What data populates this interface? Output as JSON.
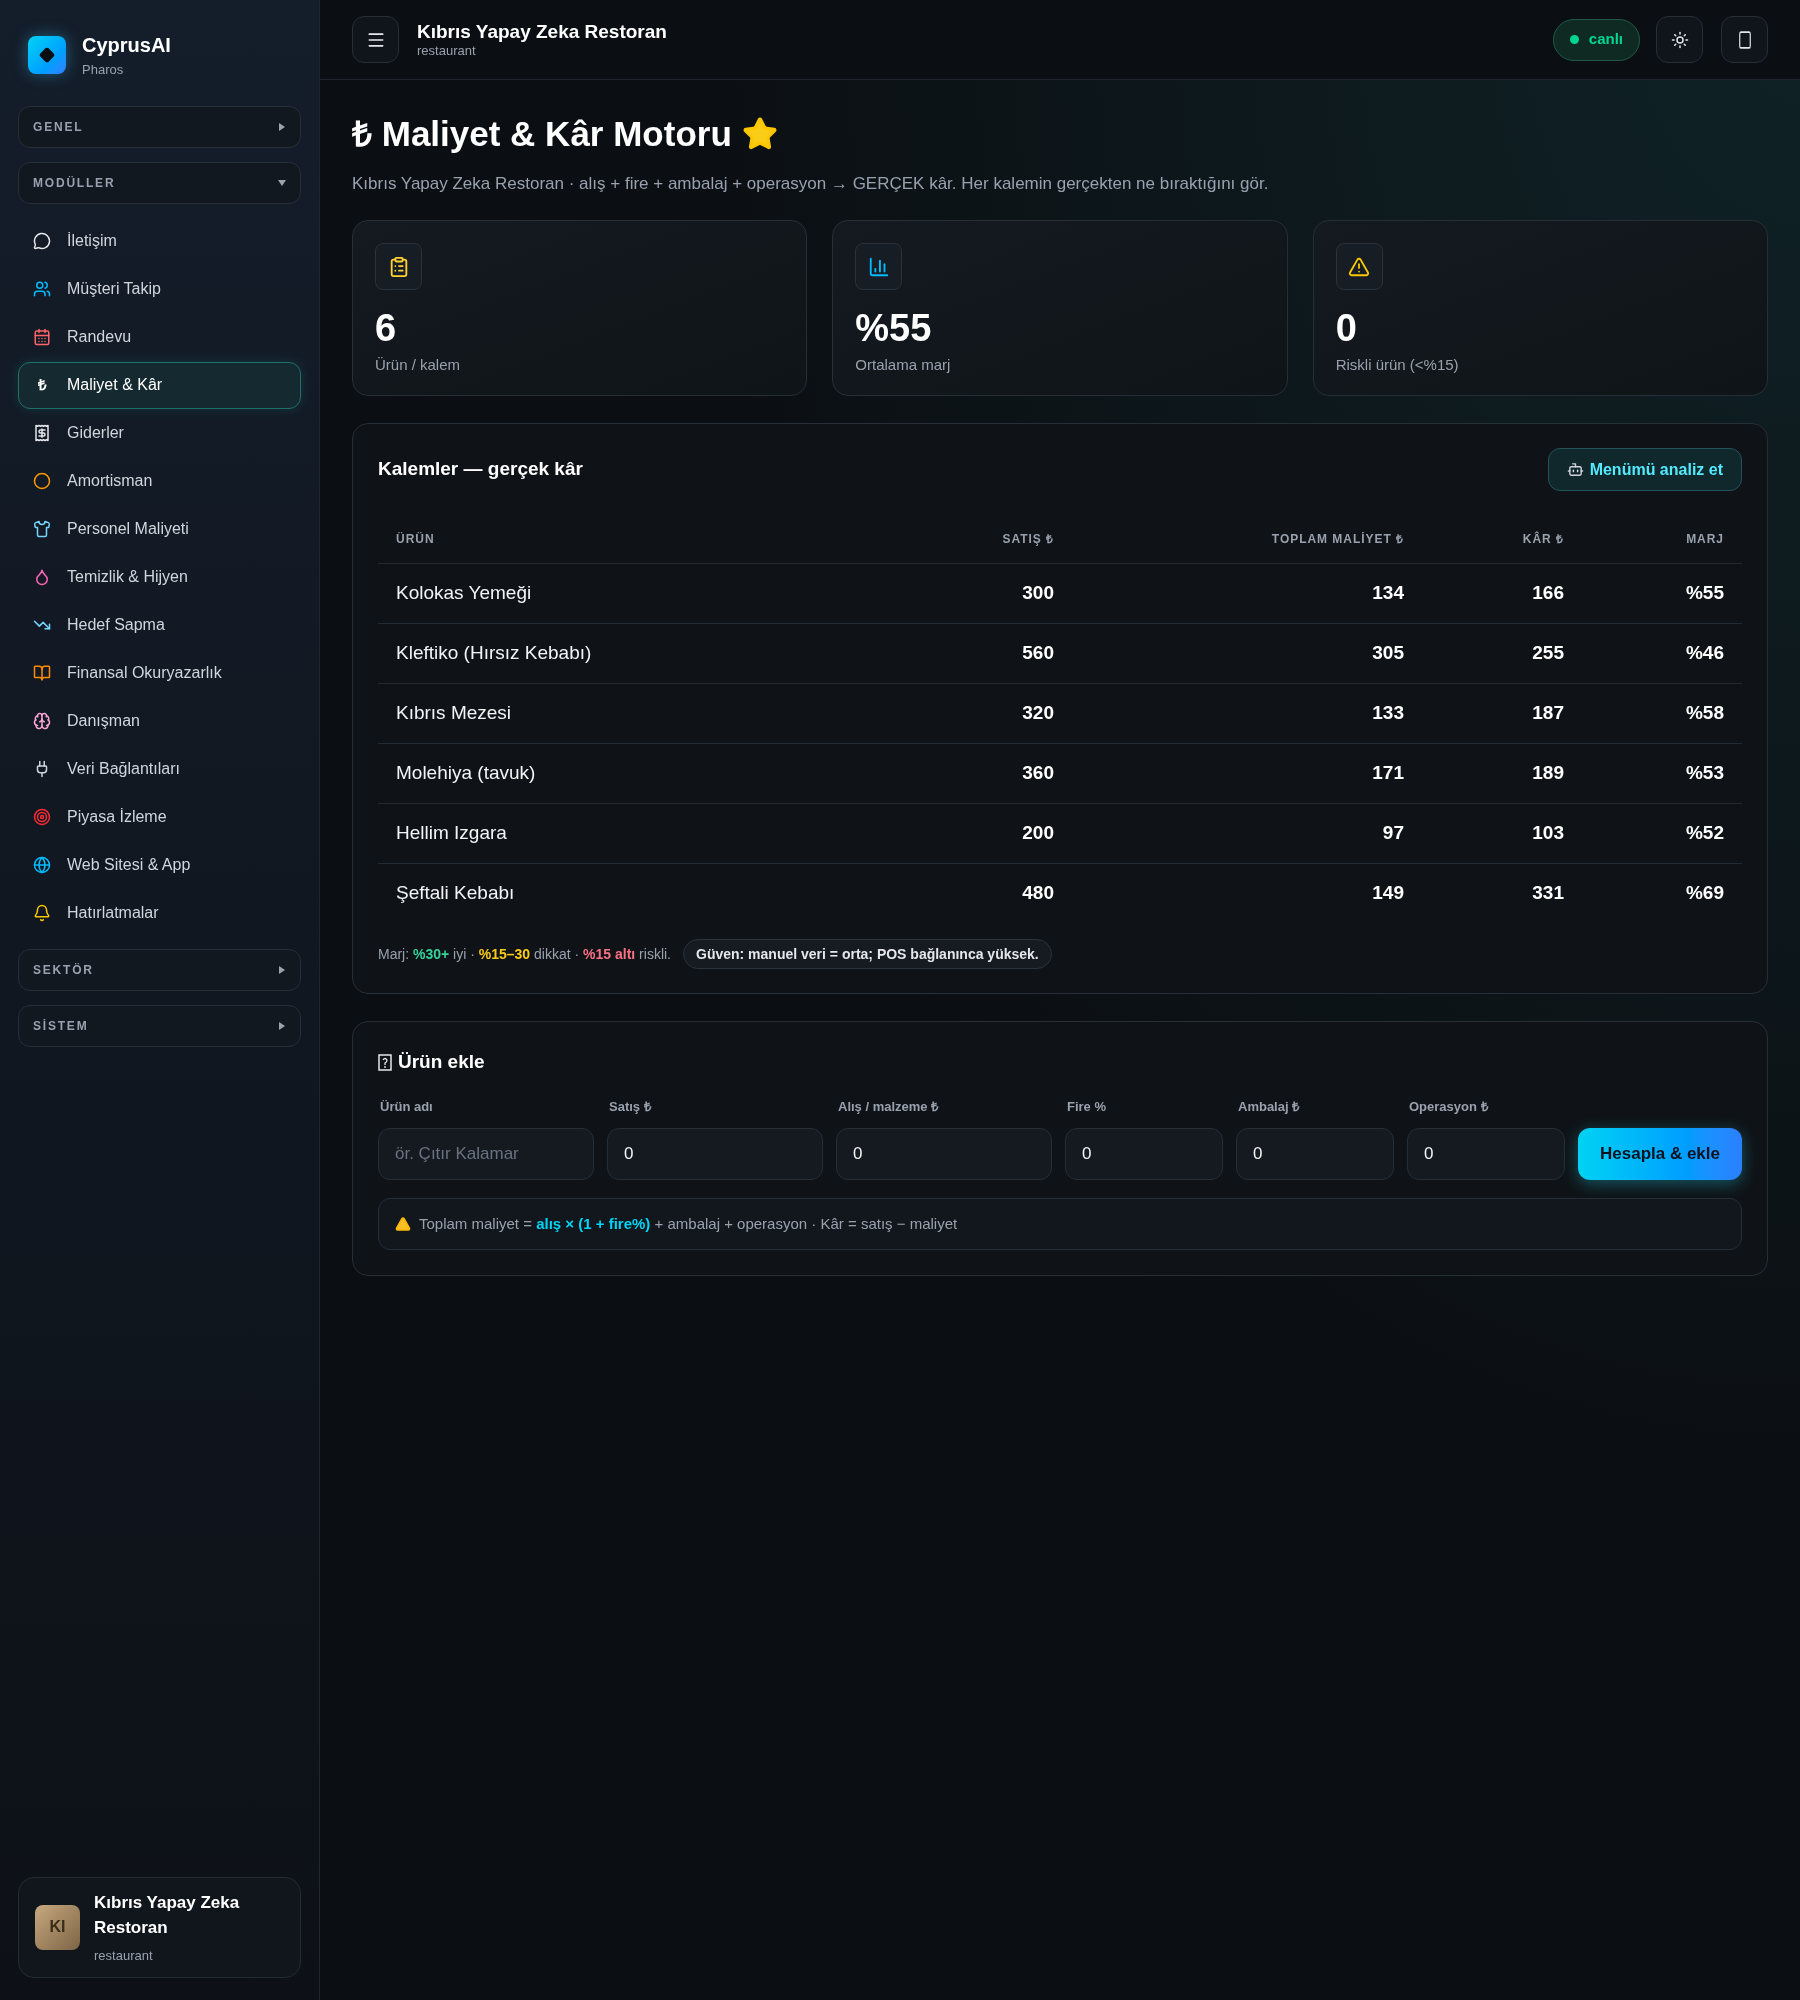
{
  "sidebar": {
    "brand": {
      "name": "CyprusAI",
      "subtitle": "Pharos"
    },
    "sections": [
      {
        "label": "GENEL",
        "expanded": false
      },
      {
        "label": "MODÜLLER",
        "expanded": true,
        "items": [
          {
            "label": "İletişim",
            "selected": false
          },
          {
            "label": "Müşteri Takip",
            "selected": false
          },
          {
            "label": "Randevu",
            "selected": false
          },
          {
            "label": "Maliyet & Kâr",
            "selected": true,
            "glyph": "₺"
          },
          {
            "label": "Giderler",
            "selected": false
          },
          {
            "label": "Amortisman",
            "selected": false
          },
          {
            "label": "Personel Maliyeti",
            "selected": false
          },
          {
            "label": "Temizlik & Hijyen",
            "selected": false
          },
          {
            "label": "Hedef Sapma",
            "selected": false
          },
          {
            "label": "Finansal Okuryazarlık",
            "selected": false
          },
          {
            "label": "Danışman",
            "selected": false
          },
          {
            "label": "Veri Bağlantıları",
            "selected": false
          },
          {
            "label": "Piyasa İzleme",
            "selected": false
          },
          {
            "label": "Web Sitesi & App",
            "selected": false
          },
          {
            "label": "Hatırlatmalar",
            "selected": false
          }
        ]
      },
      {
        "label": "SEKTÖR",
        "expanded": false
      },
      {
        "label": "SİSTEM",
        "expanded": false
      }
    ],
    "account": {
      "initials": "KI",
      "name": "Kıbrıs Yapay Zeka Restoran",
      "type": "restaurant"
    }
  },
  "header": {
    "title": "Kıbrıs Yapay Zeka Restoran",
    "subtitle": "restaurant",
    "status": {
      "label": "canlı",
      "live": true
    }
  },
  "page": {
    "title_glyph": "₺",
    "title": "Maliyet & Kâr Motoru",
    "subtitle": "Kıbrıs Yapay Zeka Restoran · alış + fire + ambalaj + operasyon → GERÇEK kâr. Her kalemin gerçekten ne bıraktığını gör.",
    "stats": [
      {
        "value": "6",
        "label": "Ürün / kalem"
      },
      {
        "value": "%55",
        "label": "Ortalama marj"
      },
      {
        "value": "0",
        "label": "Riskli ürün (<%15)"
      }
    ]
  },
  "items_card": {
    "title": "Kalemler — gerçek kâr",
    "action": "Menümü analiz et",
    "columns": [
      "ÜRÜN",
      "SATIŞ ₺",
      "TOPLAM MALİYET ₺",
      "KÂR ₺",
      "MARJ"
    ],
    "rows": [
      [
        "Kolokas Yemeği",
        "300",
        "134",
        "166",
        "%55"
      ],
      [
        "Kleftiko (Hırsız Kebabı)",
        "560",
        "305",
        "255",
        "%46"
      ],
      [
        "Kıbrıs Mezesi",
        "320",
        "133",
        "187",
        "%58"
      ],
      [
        "Molehiya (tavuk)",
        "360",
        "171",
        "189",
        "%53"
      ],
      [
        "Hellim Izgara",
        "200",
        "97",
        "103",
        "%52"
      ],
      [
        "Şeftali Kebabı",
        "480",
        "149",
        "331",
        "%69"
      ]
    ],
    "legend": [
      {
        "text": "Marj:"
      },
      {
        "text": "%30+",
        "color": "#34d399"
      },
      {
        "text": "iyi ·"
      },
      {
        "text": "%15–30",
        "color": "#facc15"
      },
      {
        "text": "dikkat ·"
      },
      {
        "text": "%15 altı",
        "color": "#fb7185"
      },
      {
        "text": "riskli."
      }
    ],
    "confidence": "Güven: manuel veri = orta; POS bağlanınca yüksek."
  },
  "form": {
    "title": "Ürün ekle",
    "fields": [
      {
        "label": "Ürün adı",
        "placeholder": "ör. Çıtır Kalamar"
      },
      {
        "label": "Satış ₺",
        "value": "0"
      },
      {
        "label": "Alış / malzeme ₺",
        "value": "0"
      },
      {
        "label": "Fire %",
        "value": "0"
      },
      {
        "label": "Ambalaj ₺",
        "value": "0"
      },
      {
        "label": "Operasyon ₺",
        "value": "0"
      }
    ],
    "submit": "Hesapla & ekle",
    "formula": "Toplam maliyet = **alış × (1 + fire%)** + ambalaj + operasyon · Kâr = satış − maliyet"
  }
}
